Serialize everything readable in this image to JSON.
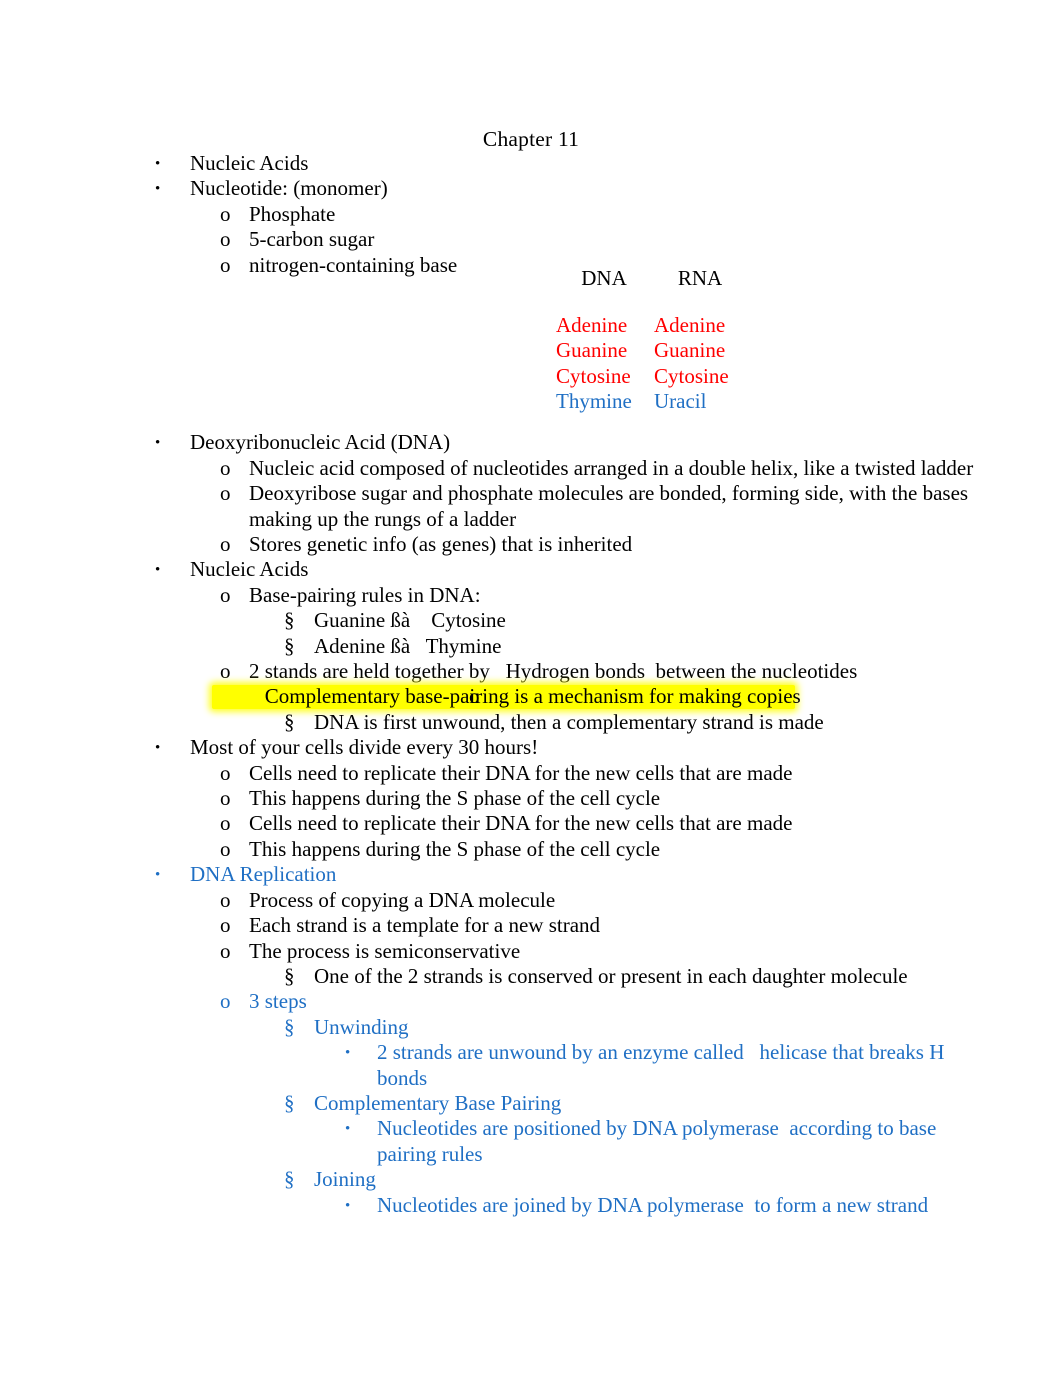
{
  "document": {
    "title": "Chapter 11"
  },
  "base_table": {
    "headers": [
      "DNA",
      "RNA"
    ],
    "rows": [
      {
        "dna": "Adenine",
        "rna": "Adenine",
        "color": "#FF0000"
      },
      {
        "dna": "Guanine",
        "rna": "Guanine",
        "color": "#FF0000"
      },
      {
        "dna": "Cytosine",
        "rna": "Cytosine",
        "color": "#FF0000"
      },
      {
        "dna": "Thymine",
        "rna": "Uracil",
        "color": "#1F6FC4"
      }
    ]
  },
  "colors": {
    "red": "#FF0000",
    "blue": "#1F6FC4",
    "highlight": "#FFFF00",
    "text": "#000000"
  },
  "markers": {
    "bullet": "•",
    "circle": "o",
    "section": "§"
  },
  "outline": [
    {
      "id": "nucleic-acids-1",
      "text": "Nucleic Acids"
    },
    {
      "id": "nucleotide-monomer",
      "text": "Nucleotide: (monomer)"
    },
    {
      "id": "phosphate",
      "text": "Phosphate"
    },
    {
      "id": "five-carbon-sugar",
      "text": "5-carbon sugar"
    },
    {
      "id": "nitrogen-containing-base",
      "text": "nitrogen-containing base"
    },
    {
      "id": "dna-heading",
      "text": "Deoxyribonucleic Acid (DNA)"
    },
    {
      "id": "dna-double-helix",
      "text": "Nucleic acid composed of nucleotides arranged in a double helix, like a twisted ladder"
    },
    {
      "id": "dna-sugar-phosphate",
      "text": "Deoxyribose sugar and phosphate molecules are bonded, forming side, with the bases making up the rungs of a ladder"
    },
    {
      "id": "dna-stores-genetic-info",
      "text": "Stores genetic info (as genes) that is inherited"
    },
    {
      "id": "nucleic-acids-2",
      "text": "Nucleic Acids"
    },
    {
      "id": "base-pairing-rules",
      "text": "Base-pairing rules in DNA:"
    },
    {
      "id": "guanine-cytosine",
      "text": "Guanine ßà    Cytosine"
    },
    {
      "id": "adenine-thymine",
      "text": "Adenine ßà   Thymine"
    },
    {
      "id": "hydrogen-bonds",
      "text": "2 stands are held together by   Hydrogen bonds  between the nucleotides"
    },
    {
      "id": "complementary-base-pairing",
      "text": "Complementary base-pairing is a mechanism for making copies"
    },
    {
      "id": "dna-unwound-strand",
      "text": "DNA is first unwound, then a complementary strand is made"
    },
    {
      "id": "cells-divide-30-hours",
      "text": "Most of your cells divide every 30 hours!"
    },
    {
      "id": "cells-replicate-dna-1",
      "text": "Cells need to replicate their DNA for the new cells that are made"
    },
    {
      "id": "s-phase-1",
      "text": "This happens during the S phase of the cell cycle"
    },
    {
      "id": "cells-replicate-dna-2",
      "text": "Cells need to replicate their DNA for the new cells that are made"
    },
    {
      "id": "s-phase-2",
      "text": "This happens during the S phase of the cell cycle"
    },
    {
      "id": "dna-replication",
      "text": "DNA Replication"
    },
    {
      "id": "process-copying",
      "text": "Process of copying a DNA molecule"
    },
    {
      "id": "each-strand-template",
      "text": "Each strand is a template for a new strand"
    },
    {
      "id": "semiconservative",
      "text": "The process is semiconservative"
    },
    {
      "id": "one-strand-conserved",
      "text": "One of the 2 strands is conserved or present in each daughter molecule"
    },
    {
      "id": "three-steps",
      "text": "3 steps"
    },
    {
      "id": "unwinding",
      "text": "Unwinding"
    },
    {
      "id": "unwinding-detail",
      "text": "2 strands are unwound by an enzyme called   helicase that breaks H bonds"
    },
    {
      "id": "complementary-base-pairing-step",
      "text": "Complementary Base Pairing"
    },
    {
      "id": "complementary-detail",
      "text": "Nucleotides are positioned by DNA polymerase  according to base pairing rules"
    },
    {
      "id": "joining",
      "text": "Joining"
    },
    {
      "id": "joining-detail",
      "text": "Nucleotides are joined by DNA polymerase  to form a new strand"
    }
  ]
}
